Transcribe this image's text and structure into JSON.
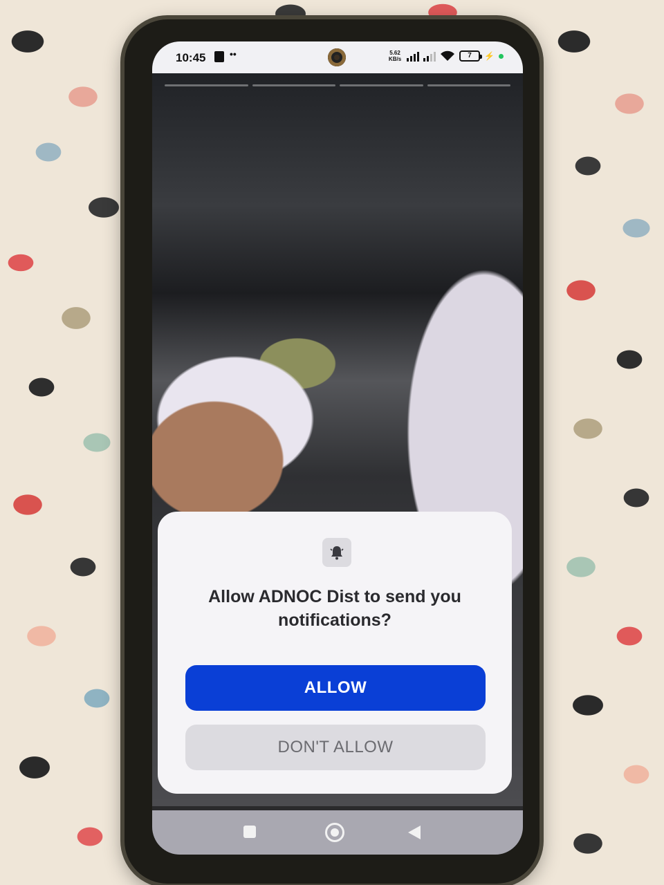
{
  "status_bar": {
    "time": "10:45",
    "dots": "••",
    "net_speed_value": "5.62",
    "net_speed_unit": "KB/s",
    "battery_level": "7"
  },
  "dialog": {
    "title": "Allow ADNOC Dist to send you notifications?",
    "allow_label": "ALLOW",
    "deny_label": "DON'T ALLOW",
    "icon": "bell-icon"
  },
  "nav_bar": {
    "icons": [
      "recent-apps-icon",
      "home-icon",
      "back-icon"
    ]
  },
  "colors": {
    "allow_button": "#0a3fd6",
    "dialog_background": "#f5f4f7",
    "deny_button": "#dcdbe0"
  }
}
